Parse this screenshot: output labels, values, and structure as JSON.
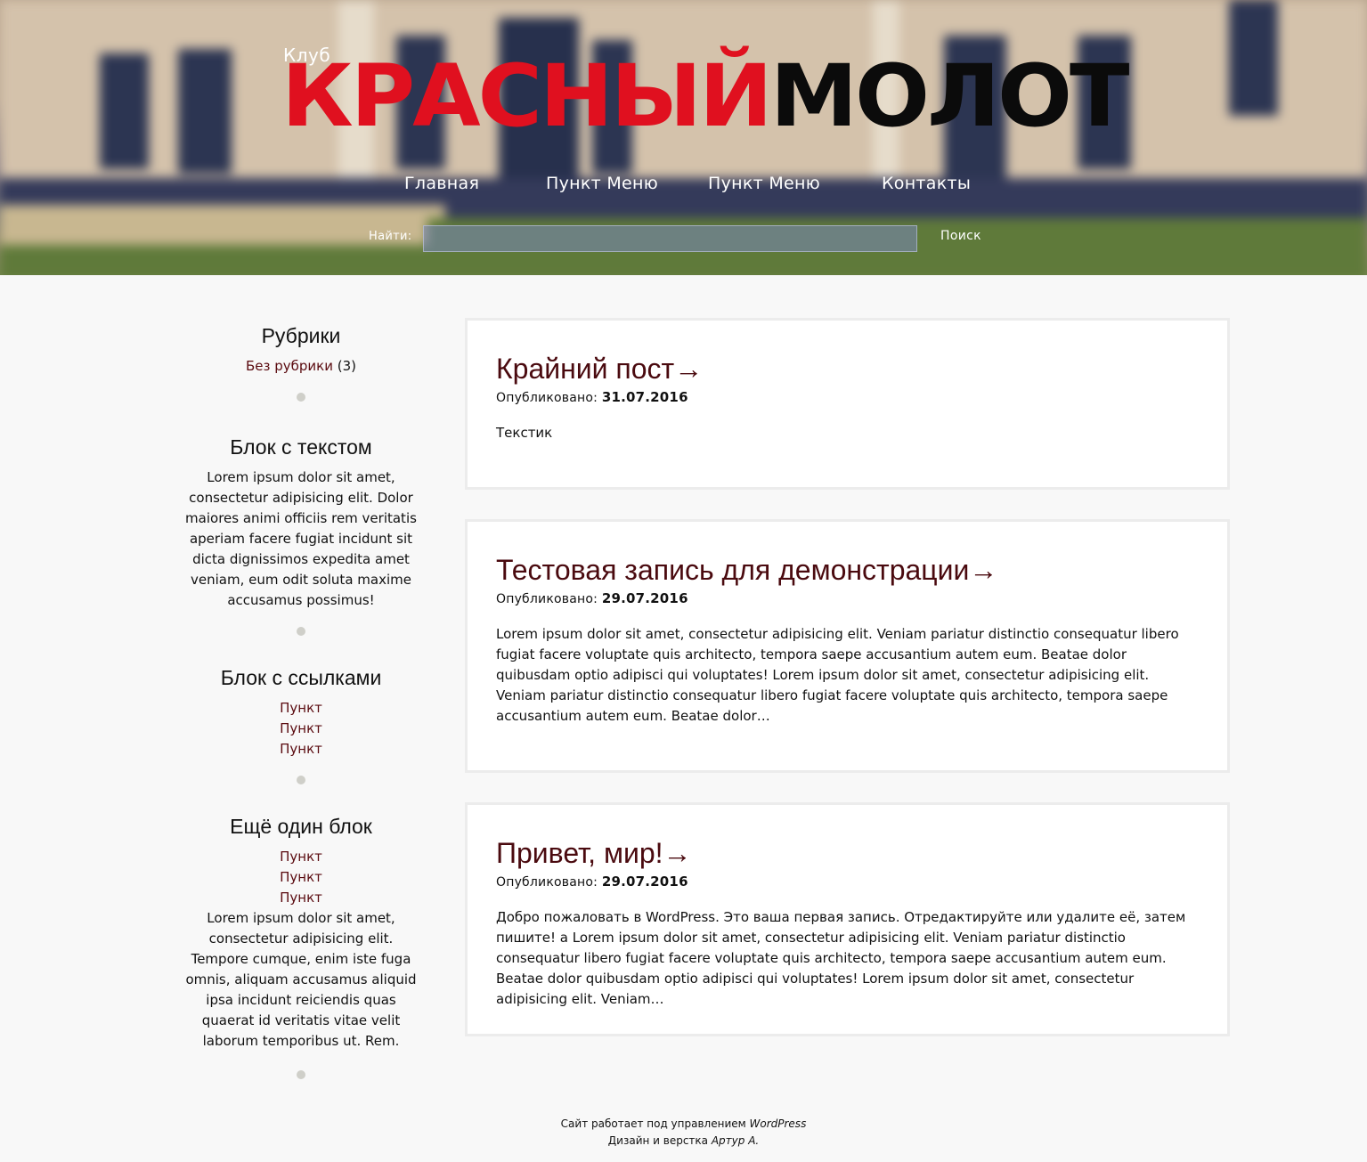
{
  "header": {
    "logo_small": "Клуб",
    "logo_red": "КРАСНЫЙ",
    "logo_black": "МОЛОТ",
    "colors": {
      "logo_red": "#e0101f",
      "logo_black": "#0b0b0b"
    }
  },
  "nav": {
    "items": [
      {
        "label": "Главная"
      },
      {
        "label": "Пункт Меню"
      },
      {
        "label": "Пункт Меню"
      },
      {
        "label": "Контакты"
      }
    ]
  },
  "search": {
    "label": "Найти:",
    "value": "",
    "placeholder": "",
    "button": "Поиск"
  },
  "sidebar": {
    "categories": {
      "title": "Рубрики",
      "item_label": "Без рубрики",
      "item_count": "(3)"
    },
    "text_block": {
      "title": "Блок с текстом",
      "text": "Lorem ipsum dolor sit amet, consectetur adipisicing elit. Dolor maiores animi officiis rem veritatis aperiam facere fugiat incidunt sit dicta dignissimos expedita amet veniam, eum odit soluta maxime accusamus possimus!"
    },
    "links_block": {
      "title": "Блок с ссылками",
      "links": [
        "Пункт",
        "Пункт",
        "Пункт"
      ]
    },
    "another_block": {
      "title": "Ещё один блок",
      "links": [
        "Пункт",
        "Пункт",
        "Пункт"
      ],
      "text": "Lorem ipsum dolor sit amet, consectetur adipisicing elit. Tempore cumque, enim iste fuga omnis, aliquam accusamus aliquid ipsa incidunt reiciendis quas quaerat id veritatis vitae velit laborum temporibus ut. Rem."
    }
  },
  "posts": [
    {
      "title": "Крайний пост→",
      "meta_label": "Опубликовано:",
      "date": "31.07.2016",
      "body": "Текстик"
    },
    {
      "title": "Тестовая запись для демонстрации→",
      "meta_label": "Опубликовано:",
      "date": "29.07.2016",
      "body": "Lorem ipsum dolor sit amet, consectetur adipisicing elit. Veniam pariatur distinctio consequatur libero fugiat facere voluptate quis architecto, tempora saepe accusantium autem eum. Beatae dolor quibusdam optio adipisci qui voluptates! Lorem ipsum dolor sit amet, consectetur adipisicing elit. Veniam pariatur distinctio consequatur libero fugiat facere voluptate quis architecto, tempora saepe accusantium autem eum. Beatae dolor…"
    },
    {
      "title": "Привет, мир!→",
      "meta_label": "Опубликовано:",
      "date": "29.07.2016",
      "body": "Добро пожаловать в WordPress. Это ваша первая запись. Отредактируйте или удалите её, затем пишите!   a Lorem ipsum dolor sit amet, consectetur adipisicing elit. Veniam pariatur distinctio consequatur libero fugiat facere voluptate quis architecto, tempora saepe accusantium autem eum. Beatae dolor quibusdam optio adipisci qui voluptates! Lorem ipsum dolor sit amet, consectetur adipisicing elit. Veniam…"
    }
  ],
  "footer": {
    "line1_text": "Сайт работает под управлением ",
    "line1_link": "WordPress",
    "line2_text": "Дизайн и верстка ",
    "line2_author": "Артур А."
  },
  "colors": {
    "post_title": "#4a0a0f",
    "link": "#5a0a0f",
    "background": "#f8f8f8"
  }
}
